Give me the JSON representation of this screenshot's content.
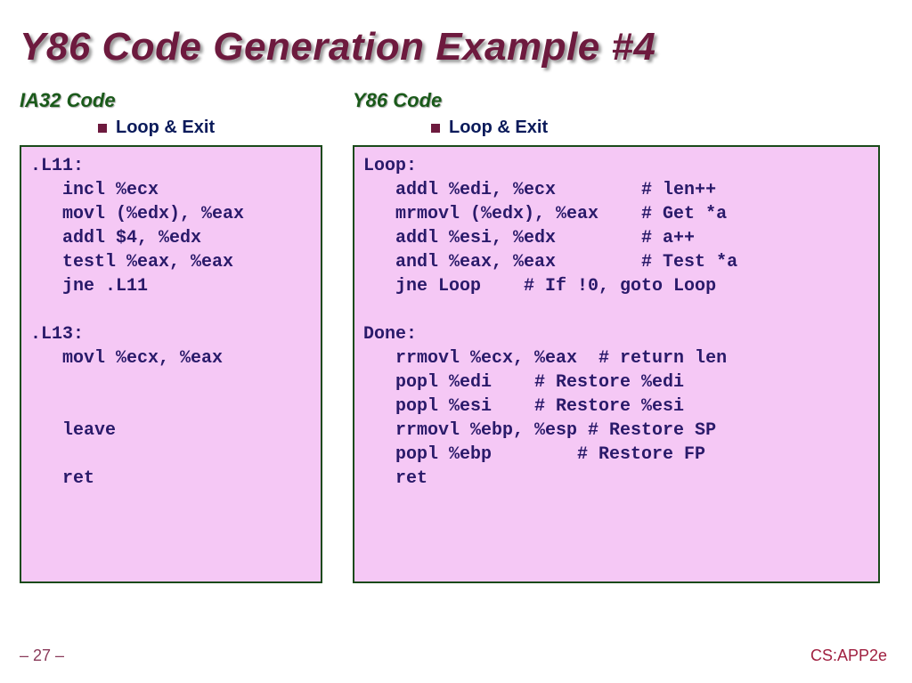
{
  "title": "Y86 Code Generation Example #4",
  "left": {
    "heading": "IA32 Code",
    "bullet": "Loop & Exit",
    "code": ".L11:\n   incl %ecx\n   movl (%edx), %eax\n   addl $4, %edx\n   testl %eax, %eax\n   jne .L11\n\n.L13:\n   movl %ecx, %eax\n\n\n   leave\n\n   ret"
  },
  "right": {
    "heading": "Y86 Code",
    "bullet": "Loop & Exit",
    "code": "Loop:\n   addl %edi, %ecx        # len++\n   mrmovl (%edx), %eax    # Get *a\n   addl %esi, %edx        # a++\n   andl %eax, %eax        # Test *a\n   jne Loop    # If !0, goto Loop\n\nDone:\n   rrmovl %ecx, %eax  # return len\n   popl %edi    # Restore %edi\n   popl %esi    # Restore %esi\n   rrmovl %ebp, %esp # Restore SP\n   popl %ebp        # Restore FP\n   ret"
  },
  "footer": {
    "left": "– 27 –",
    "right": "CS:APP2e"
  }
}
